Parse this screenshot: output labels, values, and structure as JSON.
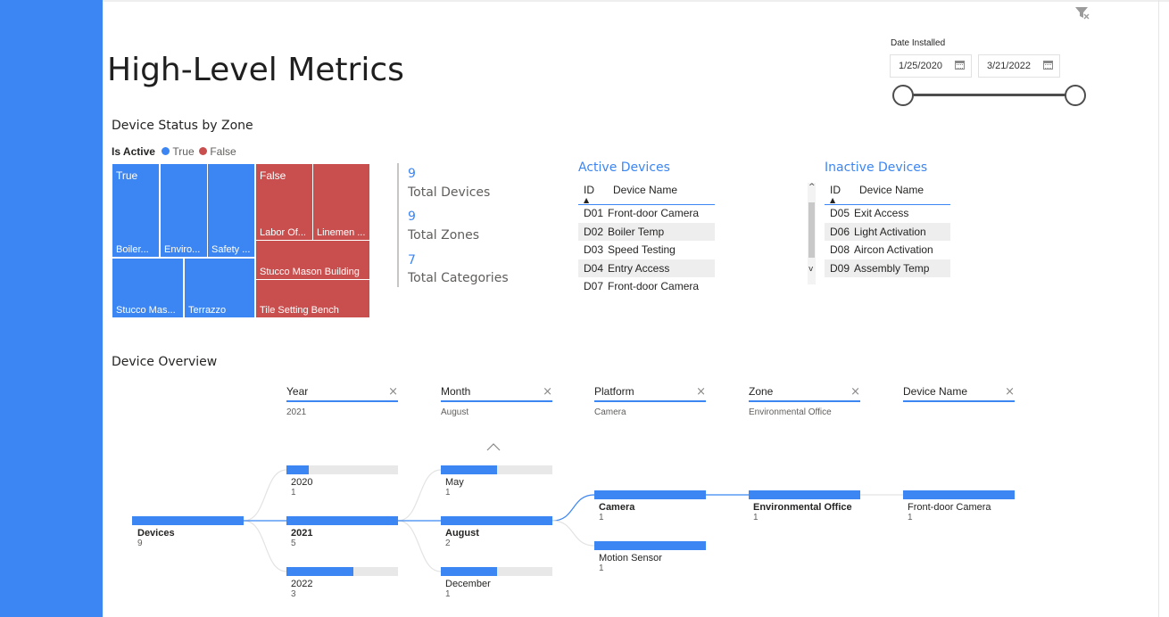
{
  "page": {
    "title": "High-Level Metrics"
  },
  "slicer": {
    "label": "Date Installed",
    "start": "1/25/2020",
    "end": "3/21/2022",
    "range_fraction": [
      0.0,
      1.0
    ]
  },
  "treemap": {
    "title": "Device Status by Zone",
    "legend_title": "Is Active",
    "legend": [
      {
        "label": "True",
        "color": "#3b86f3"
      },
      {
        "label": "False",
        "color": "#c94f4f"
      }
    ],
    "tiles": {
      "true_header": "True",
      "false_header": "False",
      "boiler": "Boiler...",
      "enviro": "Enviro...",
      "safety": "Safety ...",
      "stucco_short": "Stucco Mas...",
      "terrazzo": "Terrazzo",
      "labor": "Labor Of...",
      "linemen": "Linemen ...",
      "stucco": "Stucco Mason Building",
      "tile": "Tile Setting Bench"
    }
  },
  "cards": [
    {
      "value": "9",
      "label": "Total Devices"
    },
    {
      "value": "9",
      "label": "Total Zones"
    },
    {
      "value": "7",
      "label": "Total Categories"
    }
  ],
  "active_table": {
    "title": "Active Devices",
    "headers": [
      "ID",
      "Device Name"
    ],
    "rows": [
      [
        "D01",
        "Front-door Camera"
      ],
      [
        "D02",
        "Boiler Temp"
      ],
      [
        "D03",
        "Speed Testing"
      ],
      [
        "D04",
        "Entry Access"
      ],
      [
        "D07",
        "Front-door Camera"
      ]
    ]
  },
  "inactive_table": {
    "title": "Inactive Devices",
    "headers": [
      "ID",
      "Device Name"
    ],
    "rows": [
      [
        "D05",
        "Exit Access"
      ],
      [
        "D06",
        "Light Activation"
      ],
      [
        "D08",
        "Aircon Activation"
      ],
      [
        "D09",
        "Assembly Temp"
      ]
    ]
  },
  "decomp": {
    "title": "Device Overview",
    "columns": [
      {
        "name": "Year",
        "filter": "2021"
      },
      {
        "name": "Month",
        "filter": "August"
      },
      {
        "name": "Platform",
        "filter": "Camera"
      },
      {
        "name": "Zone",
        "filter": "Environmental Office"
      },
      {
        "name": "Device Name",
        "filter": ""
      }
    ],
    "root": {
      "label": "Devices",
      "value": "9"
    },
    "year_nodes": [
      {
        "label": "2020",
        "value": "1",
        "fraction": 0.2
      },
      {
        "label": "2021",
        "value": "5",
        "fraction": 1.0
      },
      {
        "label": "2022",
        "value": "3",
        "fraction": 0.6
      }
    ],
    "month_nodes": [
      {
        "label": "May",
        "value": "1",
        "fraction": 0.5
      },
      {
        "label": "August",
        "value": "2",
        "fraction": 1.0
      },
      {
        "label": "December",
        "value": "1",
        "fraction": 0.5
      }
    ],
    "platform_nodes": [
      {
        "label": "Camera",
        "value": "1",
        "fraction": 1.0
      },
      {
        "label": "Motion Sensor",
        "value": "1",
        "fraction": 1.0
      }
    ],
    "zone_nodes": [
      {
        "label": "Environmental Office",
        "value": "1",
        "fraction": 1.0
      }
    ],
    "device_nodes": [
      {
        "label": "Front-door Camera",
        "value": "1",
        "fraction": 1.0
      }
    ]
  }
}
